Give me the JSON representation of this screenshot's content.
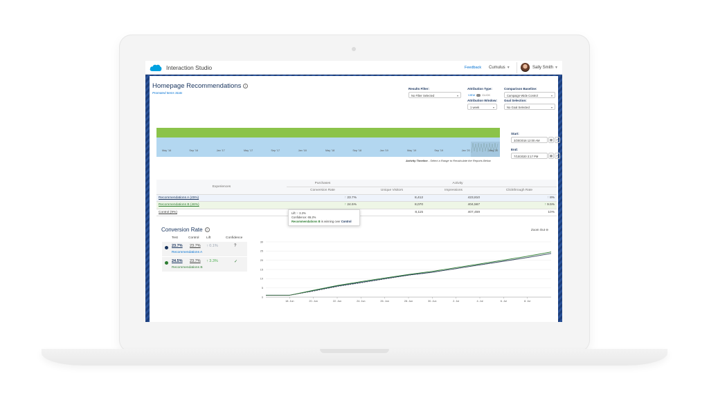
{
  "header": {
    "app_name": "Interaction Studio",
    "feedback": "Feedback",
    "dataset": "Cumulus",
    "user": "Sally Smith"
  },
  "page": {
    "title": "Homepage Recommendations",
    "subtitle": "Promoted Items Stats"
  },
  "filters": {
    "results_filter_label": "Results Filter:",
    "results_filter_value": "No Filter Selected",
    "attribution_type_label": "Attribution Type:",
    "attribution_view": "VIEW",
    "attribution_click": "CLICK",
    "attribution_window_label": "Attribution Window:",
    "attribution_window_value": "1 week",
    "comparison_baseline_label": "Comparison Baseline:",
    "comparison_baseline_value": "Campaign-Wide Control",
    "goal_selection_label": "Goal Selection:",
    "goal_selection_value": "No Goal Selected"
  },
  "timeline": {
    "ticks": [
      "May '16",
      "Sep '16",
      "Jan '17",
      "May '17",
      "Sep '17",
      "Jan '18",
      "May '18",
      "Sep '18",
      "Jan '19",
      "May '19",
      "Sep '19",
      "Jan '20",
      "May '20"
    ],
    "caption_bold": "Activity Timeline",
    "caption_rest": " - Select a Range to Recalculate the Reports Below",
    "start_label": "Start:",
    "start_value": "3/20/2016 12:00 AM",
    "end_label": "End:",
    "end_value": "7/10/2020 3:17 PM"
  },
  "table": {
    "experiences_header": "Experiences",
    "purchases_header": "Purchases",
    "activity_header": "Activity",
    "columns": [
      "Conversion Rate",
      "Unique Visitors",
      "Impressions",
      "Clickthrough Rate"
    ],
    "rows": [
      {
        "name": "Recommendations A (45%)",
        "conversion": "23.7%",
        "visitors": "8,412",
        "impressions": "423,810",
        "ctr": "8%"
      },
      {
        "name": "Recommendations B (46%)",
        "conversion": "24.5%",
        "visitors": "8,070",
        "impressions": "404,567",
        "ctr": "9.5%"
      },
      {
        "name": "Control (9%)",
        "conversion": "",
        "visitors": "8,115",
        "impressions": "407,459",
        "ctr": "10%"
      }
    ],
    "up_arrow": "↑"
  },
  "tooltip": {
    "lift": "Lift: ↑ 3.3%",
    "confidence": "Confidence: 65.2%",
    "winner": "Recommendations B",
    "winner_rest": " is winning over ",
    "loser": "Control"
  },
  "conversion_rate": {
    "title": "Conversion Rate",
    "zoom_out": "Zoom Out",
    "headers": {
      "test": "Test",
      "control": "Control",
      "lift": "Lift",
      "confidence": "Confidence"
    },
    "rows": [
      {
        "test": "23.7%",
        "control": "23.7%",
        "lift": "↑ 0.1%",
        "name": "Recommendations A",
        "color": "#16325c",
        "lift_color": "#9aa4b2",
        "confidence_icon": "question-icon"
      },
      {
        "test": "24.5%",
        "control": "23.7%",
        "lift": "↑ 3.3%",
        "name": "Recommendations B",
        "color": "#2e7d32",
        "lift_color": "#4caf50",
        "confidence_icon": "check-icon"
      }
    ]
  },
  "chart_data": {
    "type": "line",
    "x": [
      "16 Jun",
      "18 Jun",
      "20 Jun",
      "22 Jun",
      "24 Jun",
      "26 Jun",
      "28 Jun",
      "30 Jun",
      "2 Jul",
      "4 Jul",
      "6 Jul",
      "8 Jul",
      "10 Jul"
    ],
    "x_ticks": [
      "18. Jun",
      "20. Jun",
      "22. Jun",
      "24. Jun",
      "26. Jun",
      "28. Jun",
      "30. Jun",
      "2. Jul",
      "4. Jul",
      "6. Jul",
      "8. Jul"
    ],
    "y_ticks": [
      0,
      5,
      10,
      15,
      20,
      25,
      30
    ],
    "ylim": [
      0,
      30
    ],
    "series": [
      {
        "name": "Recommendations A",
        "color": "#1e3a5f",
        "values": [
          1,
          1,
          3.5,
          6,
          8,
          10,
          12,
          13.5,
          15.5,
          17.5,
          19.5,
          21.5,
          23.7
        ]
      },
      {
        "name": "Recommendations B",
        "color": "#2e7d32",
        "values": [
          1,
          1,
          3.7,
          6.3,
          8.4,
          10.4,
          12.3,
          14,
          16,
          18,
          20.1,
          22.2,
          24.5
        ]
      },
      {
        "name": "Control",
        "color": "#555555",
        "dashed": true,
        "values": [
          1,
          1,
          3.2,
          5.7,
          7.7,
          9.8,
          11.8,
          13.4,
          15.4,
          17.4,
          19.4,
          21.5,
          23.7
        ]
      }
    ]
  }
}
